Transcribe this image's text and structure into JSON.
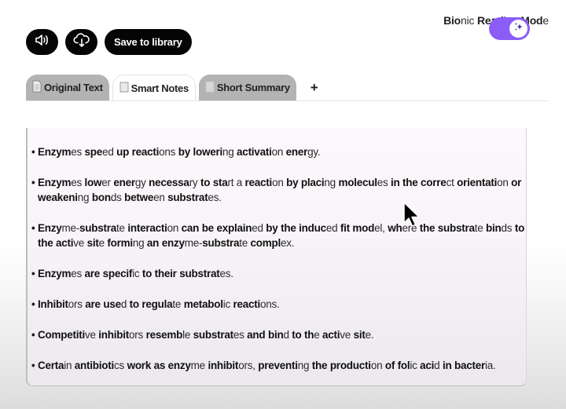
{
  "toolbar": {
    "audio_icon": "speaker-icon",
    "download_icon": "cloud-download-icon",
    "save_label": "Save to library"
  },
  "bionic_mode": {
    "label_segments": [
      {
        "b": "Bio",
        "r": "nic "
      },
      {
        "b": "Read",
        "r": "ing "
      },
      {
        "b": "Mod",
        "r": "e"
      }
    ],
    "enabled": true,
    "accent_color": "#8b5cf6",
    "knob_icon": "sparkles-icon"
  },
  "tabs": [
    {
      "label": "Original Text",
      "icon": "document-icon",
      "active": false
    },
    {
      "label": "Smart Notes",
      "icon": "notepad-icon",
      "active": true
    },
    {
      "label": "Short Summary",
      "icon": "page-icon",
      "active": false
    }
  ],
  "add_tab_label": "+",
  "notes": [
    [
      [
        "Enzym",
        "es"
      ],
      [
        "spe",
        "ed"
      ],
      [
        "up",
        ""
      ],
      [
        "reacti",
        "ons"
      ],
      [
        "by",
        ""
      ],
      [
        "loweri",
        "ng"
      ],
      [
        "activati",
        "on"
      ],
      [
        "ener",
        "gy."
      ]
    ],
    [
      [
        "Enzym",
        "es"
      ],
      [
        "low",
        "er"
      ],
      [
        "ener",
        "gy"
      ],
      [
        "necessa",
        "ry"
      ],
      [
        "to",
        ""
      ],
      [
        "sta",
        "rt"
      ],
      [
        "",
        "a"
      ],
      [
        "reacti",
        "on"
      ],
      [
        "by",
        ""
      ],
      [
        "placi",
        "ng"
      ],
      [
        "molecul",
        "es"
      ],
      [
        "in",
        ""
      ],
      [
        "the",
        ""
      ],
      [
        "corre",
        "ct"
      ],
      [
        "orientati",
        "on"
      ],
      [
        "or",
        ""
      ],
      [
        "weakeni",
        "ng"
      ],
      [
        "bon",
        "ds"
      ],
      [
        "betwe",
        "en"
      ],
      [
        "substrat",
        "es."
      ]
    ],
    [
      [
        "Enzy",
        "me-"
      ],
      [
        "substra",
        "te"
      ],
      [
        "interacti",
        "on"
      ],
      [
        "can",
        ""
      ],
      [
        "be",
        ""
      ],
      [
        "explain",
        "ed"
      ],
      [
        "by",
        ""
      ],
      [
        "the",
        ""
      ],
      [
        "induc",
        "ed"
      ],
      [
        "fit",
        ""
      ],
      [
        "mod",
        "el,"
      ],
      [
        "wh",
        "ere"
      ],
      [
        "the",
        ""
      ],
      [
        "substra",
        "te"
      ],
      [
        "bin",
        "ds"
      ],
      [
        "to",
        ""
      ],
      [
        "the",
        ""
      ],
      [
        "acti",
        "ve"
      ],
      [
        "sit",
        "e"
      ],
      [
        "formi",
        "ng"
      ],
      [
        "an",
        ""
      ],
      [
        "enzy",
        "me-"
      ],
      [
        "substra",
        "te"
      ],
      [
        "compl",
        "ex."
      ]
    ],
    [
      [
        "Enzym",
        "es"
      ],
      [
        "are",
        ""
      ],
      [
        "specif",
        "ic"
      ],
      [
        "to",
        ""
      ],
      [
        "their",
        ""
      ],
      [
        "substrat",
        "es."
      ]
    ],
    [
      [
        "Inhibit",
        "ors"
      ],
      [
        "are",
        ""
      ],
      [
        "use",
        "d"
      ],
      [
        "to",
        ""
      ],
      [
        "regula",
        "te"
      ],
      [
        "metabol",
        "ic"
      ],
      [
        "reacti",
        "ons."
      ]
    ],
    [
      [
        "Competiti",
        "ve"
      ],
      [
        "inhibit",
        "ors"
      ],
      [
        "resemb",
        "le"
      ],
      [
        "substrat",
        "es"
      ],
      [
        "and",
        ""
      ],
      [
        "bin",
        "d"
      ],
      [
        "to",
        ""
      ],
      [
        "th",
        "e"
      ],
      [
        "acti",
        "ve"
      ],
      [
        "sit",
        "e."
      ]
    ],
    [
      [
        "Certa",
        "in"
      ],
      [
        "antibioti",
        "cs"
      ],
      [
        "work",
        ""
      ],
      [
        "as",
        ""
      ],
      [
        "enzy",
        "me"
      ],
      [
        "inhibit",
        "ors,"
      ],
      [
        "preventi",
        "ng"
      ],
      [
        "the",
        ""
      ],
      [
        "producti",
        "on"
      ],
      [
        "of",
        ""
      ],
      [
        "fol",
        "ic"
      ],
      [
        "aci",
        "d"
      ],
      [
        "in",
        ""
      ],
      [
        "bacter",
        "ia."
      ]
    ]
  ]
}
